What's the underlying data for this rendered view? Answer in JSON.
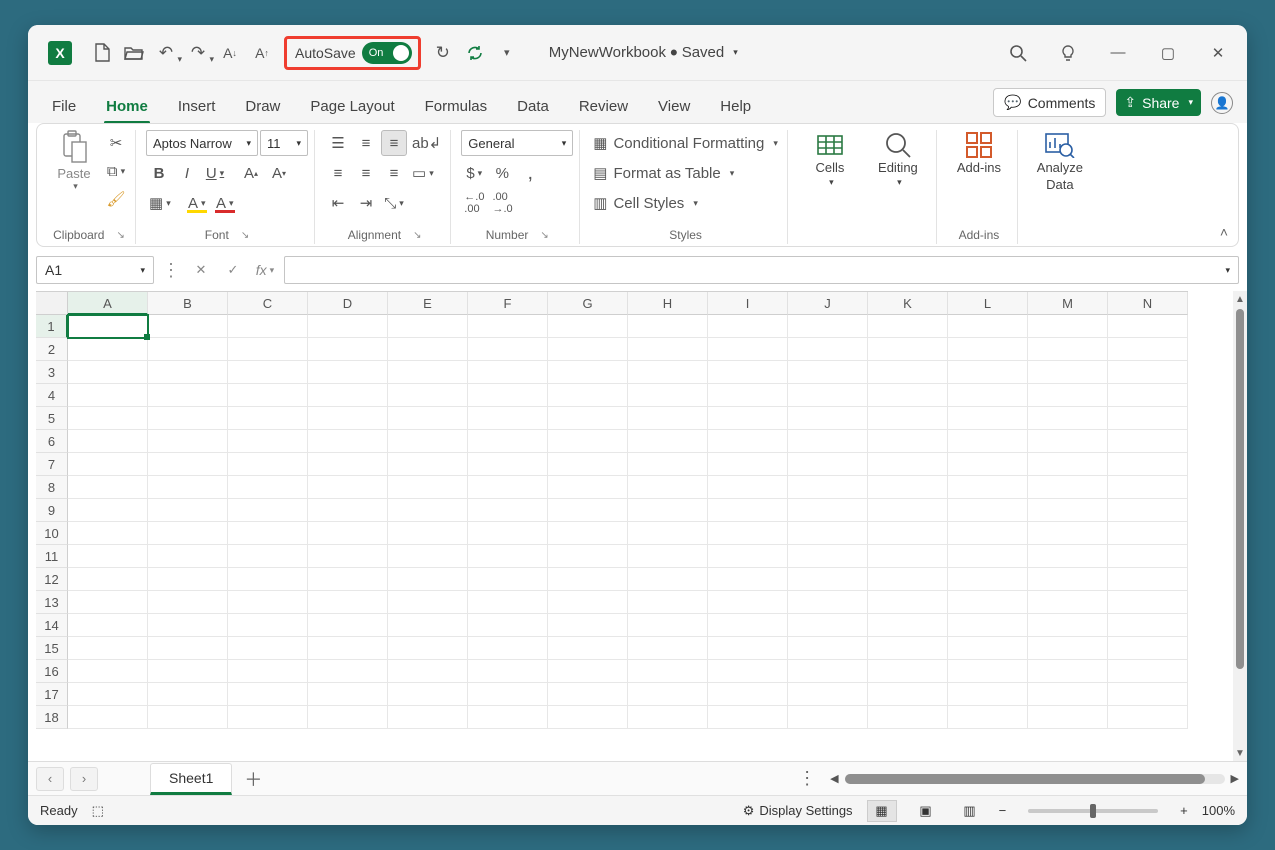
{
  "qat": {
    "autosave_label": "AutoSave",
    "autosave_state": "On"
  },
  "workbook": {
    "name": "MyNewWorkbook",
    "status": "Saved"
  },
  "tabs": [
    "File",
    "Home",
    "Insert",
    "Draw",
    "Page Layout",
    "Formulas",
    "Data",
    "Review",
    "View",
    "Help"
  ],
  "active_tab": "Home",
  "right_buttons": {
    "comments": "Comments",
    "share": "Share"
  },
  "ribbon": {
    "clipboard": {
      "paste": "Paste",
      "label": "Clipboard"
    },
    "font": {
      "name": "Aptos Narrow",
      "size": "11",
      "label": "Font"
    },
    "alignment": {
      "label": "Alignment"
    },
    "number": {
      "format": "General",
      "label": "Number"
    },
    "styles": {
      "conditional": "Conditional Formatting",
      "table": "Format as Table",
      "cellstyles": "Cell Styles",
      "label": "Styles"
    },
    "cells": {
      "label": "Cells"
    },
    "editing": {
      "label": "Editing"
    },
    "addins": {
      "button": "Add-ins",
      "label": "Add-ins"
    },
    "analyze": {
      "line1": "Analyze",
      "line2": "Data"
    }
  },
  "formula_bar": {
    "name_box": "A1",
    "fx": "fx"
  },
  "columns": [
    "A",
    "B",
    "C",
    "D",
    "E",
    "F",
    "G",
    "H",
    "I",
    "J",
    "K",
    "L",
    "M",
    "N"
  ],
  "rows_count": 18,
  "selected_cell": {
    "row": 1,
    "col": "A"
  },
  "sheet_tabs": [
    "Sheet1"
  ],
  "status_bar": {
    "ready": "Ready",
    "display_settings": "Display Settings",
    "zoom": "100%"
  }
}
